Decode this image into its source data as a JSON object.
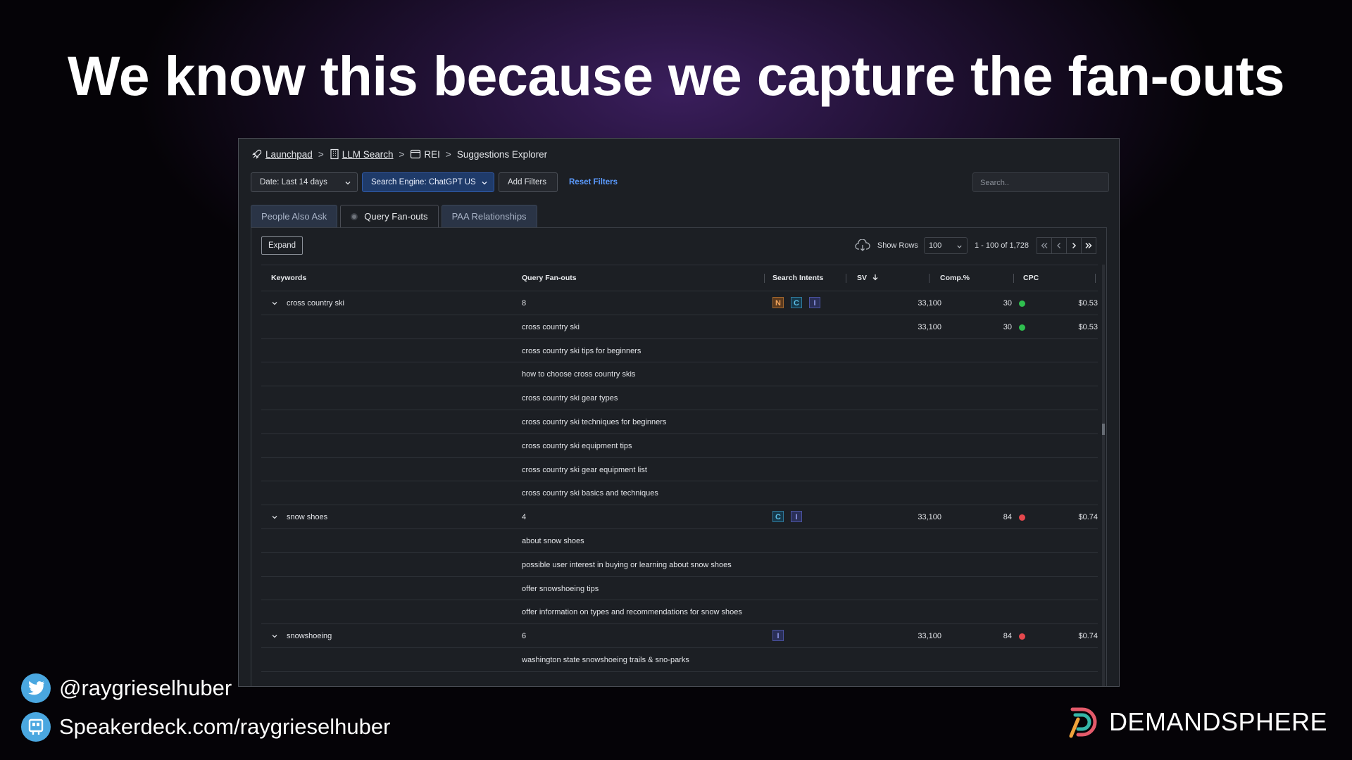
{
  "slide": {
    "title": "We know this because we capture the fan-outs",
    "twitter": "@raygrieselhuber",
    "speakerdeck": "Speakerdeck.com/raygrieselhuber",
    "brand": "DEMANDSPHERE"
  },
  "breadcrumb": {
    "launchpad": "Launchpad",
    "llm_search": "LLM Search",
    "rei": "REI",
    "current": "Suggestions Explorer",
    "sep": ">"
  },
  "toolbar": {
    "date": "Date: Last 14 days",
    "engine": "Search Engine: ChatGPT US",
    "add_filters": "Add Filters",
    "reset_filters": "Reset Filters",
    "search_placeholder": "Search.."
  },
  "tabs": [
    "People Also Ask",
    "Query Fan-outs",
    "PAA Relationships"
  ],
  "active_tab": "Query Fan-outs",
  "controls": {
    "expand": "Expand",
    "show_rows_label": "Show Rows",
    "show_rows_value": "100",
    "range": "1 - 100 of 1,728"
  },
  "columns": {
    "keywords": "Keywords",
    "fanouts": "Query Fan-outs",
    "intents": "Search Intents",
    "sv": "SV",
    "comp": "Comp.%",
    "cpc": "CPC"
  },
  "colors": {
    "comp_low": "#2fbf4f",
    "comp_high": "#e5484d",
    "accent": "#5b9bff"
  },
  "rows": [
    {
      "keyword": "cross country ski",
      "fanout": "8",
      "intents": [
        "N",
        "C",
        "I"
      ],
      "sv": "33,100",
      "comp": "30",
      "comp_level": "low",
      "cpc": "$0.53",
      "parent": true
    },
    {
      "keyword": "",
      "fanout": "cross country ski",
      "intents": [],
      "sv": "33,100",
      "comp": "30",
      "comp_level": "low",
      "cpc": "$0.53",
      "parent": false
    },
    {
      "keyword": "",
      "fanout": "cross country ski tips for beginners",
      "intents": [],
      "sv": "",
      "comp": "",
      "comp_level": "",
      "cpc": "",
      "parent": false
    },
    {
      "keyword": "",
      "fanout": "how to choose cross country skis",
      "intents": [],
      "sv": "",
      "comp": "",
      "comp_level": "",
      "cpc": "",
      "parent": false
    },
    {
      "keyword": "",
      "fanout": "cross country ski gear types",
      "intents": [],
      "sv": "",
      "comp": "",
      "comp_level": "",
      "cpc": "",
      "parent": false
    },
    {
      "keyword": "",
      "fanout": "cross country ski techniques for beginners",
      "intents": [],
      "sv": "",
      "comp": "",
      "comp_level": "",
      "cpc": "",
      "parent": false
    },
    {
      "keyword": "",
      "fanout": "cross country ski equipment tips",
      "intents": [],
      "sv": "",
      "comp": "",
      "comp_level": "",
      "cpc": "",
      "parent": false
    },
    {
      "keyword": "",
      "fanout": "cross country ski gear equipment list",
      "intents": [],
      "sv": "",
      "comp": "",
      "comp_level": "",
      "cpc": "",
      "parent": false
    },
    {
      "keyword": "",
      "fanout": "cross country ski basics and techniques",
      "intents": [],
      "sv": "",
      "comp": "",
      "comp_level": "",
      "cpc": "",
      "parent": false
    },
    {
      "keyword": "snow shoes",
      "fanout": "4",
      "intents": [
        "C",
        "I"
      ],
      "sv": "33,100",
      "comp": "84",
      "comp_level": "high",
      "cpc": "$0.74",
      "parent": true
    },
    {
      "keyword": "",
      "fanout": "about snow shoes",
      "intents": [],
      "sv": "",
      "comp": "",
      "comp_level": "",
      "cpc": "",
      "parent": false
    },
    {
      "keyword": "",
      "fanout": "possible user interest in buying or learning about snow shoes",
      "intents": [],
      "sv": "",
      "comp": "",
      "comp_level": "",
      "cpc": "",
      "parent": false
    },
    {
      "keyword": "",
      "fanout": "offer snowshoeing tips",
      "intents": [],
      "sv": "",
      "comp": "",
      "comp_level": "",
      "cpc": "",
      "parent": false
    },
    {
      "keyword": "",
      "fanout": "offer information on types and recommendations for snow shoes",
      "intents": [],
      "sv": "",
      "comp": "",
      "comp_level": "",
      "cpc": "",
      "parent": false
    },
    {
      "keyword": "snowshoeing",
      "fanout": "6",
      "intents": [
        "I"
      ],
      "sv": "33,100",
      "comp": "84",
      "comp_level": "high",
      "cpc": "$0.74",
      "parent": true
    },
    {
      "keyword": "",
      "fanout": "washington state snowshoeing trails & sno-parks",
      "intents": [],
      "sv": "",
      "comp": "",
      "comp_level": "",
      "cpc": "",
      "parent": false
    }
  ]
}
